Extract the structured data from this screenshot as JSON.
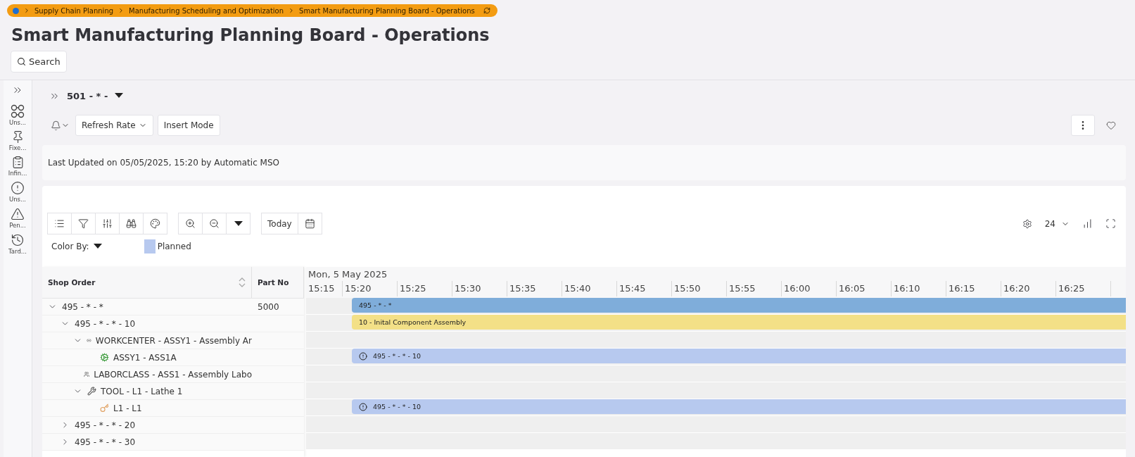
{
  "breadcrumb": [
    "Supply Chain Planning",
    "Manufacturing Scheduling and Optimization",
    "Smart Manufacturing Planning Board - Operations"
  ],
  "title": "Smart Manufacturing Planning Board - Operations",
  "search_button": "Search",
  "side_rail": [
    {
      "label": "Uns..."
    },
    {
      "label": "Fixe..."
    },
    {
      "label": "Infin..."
    },
    {
      "label": "Uns..."
    },
    {
      "label": "Pen..."
    },
    {
      "label": "Tard..."
    }
  ],
  "selector": "501 - * -",
  "toolbar": {
    "refresh_rate": "Refresh Rate",
    "insert_mode": "Insert Mode"
  },
  "last_updated": "Last Updated on 05/05/2025, 15:20 by Automatic MSO",
  "gantt": {
    "today": "Today",
    "rows_per_page": "24",
    "color_by": "Color By:",
    "legend": [
      {
        "label": "Planned",
        "color": "#b7c9ef"
      }
    ],
    "columns": [
      "Shop Order",
      "Part No"
    ],
    "date": "Mon, 5 May 2025",
    "ticks": [
      "15:15",
      "15:20",
      "15:25",
      "15:30",
      "15:35",
      "15:40",
      "15:45",
      "15:50",
      "15:55",
      "16:00",
      "16:05",
      "16:10",
      "16:15",
      "16:20",
      "16:25"
    ],
    "rows": [
      {
        "label": "495 - * - *",
        "part_no": "5000",
        "expanded": true,
        "bar": {
          "color": "#7fadda",
          "label": "495 - * - *",
          "warning": false
        },
        "children": [
          {
            "label": "495 - * - * - 10",
            "expanded": true,
            "bar": {
              "color": "#f3e087",
              "label": "10 - Inital Component Assembly",
              "warning": false
            },
            "children": [
              {
                "label": "WORKCENTER - ASSY1 - Assembly Ar",
                "kind": "workcenter",
                "expanded": true,
                "children": [
                  {
                    "label": "ASSY1 - ASS1A",
                    "kind": "resource",
                    "bar": {
                      "color": "#b7c9ef",
                      "label": "495 - * - * - 10",
                      "warning": true
                    }
                  }
                ]
              },
              {
                "label": "LABORCLASS - ASS1 - Assembly Labo",
                "kind": "laborclass"
              },
              {
                "label": "TOOL - L1 - Lathe 1",
                "kind": "tool",
                "expanded": true,
                "children": [
                  {
                    "label": "L1 - L1",
                    "kind": "key",
                    "bar": {
                      "color": "#b7c9ef",
                      "label": "495 - * - * - 10",
                      "warning": true
                    }
                  }
                ]
              }
            ]
          },
          {
            "label": "495 - * - * - 20",
            "expanded": false
          },
          {
            "label": "495 - * - * - 30",
            "expanded": false
          }
        ]
      }
    ]
  }
}
